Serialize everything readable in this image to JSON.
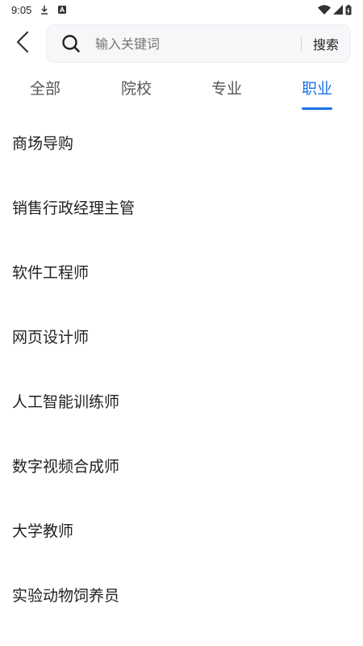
{
  "status_bar": {
    "time": "9:05",
    "icons": [
      "download-icon",
      "a-icon",
      "wifi-icon",
      "signal-icon",
      "battery-icon"
    ]
  },
  "header": {
    "back_icon": "chevron-left-icon",
    "search": {
      "icon": "search-icon",
      "placeholder": "输入关键词",
      "value": "",
      "button_label": "搜索"
    }
  },
  "tabs": [
    {
      "label": "全部",
      "active": false
    },
    {
      "label": "院校",
      "active": false
    },
    {
      "label": "专业",
      "active": false
    },
    {
      "label": "职业",
      "active": true
    }
  ],
  "list": {
    "items": [
      {
        "label": "商场导购"
      },
      {
        "label": "销售行政经理主管"
      },
      {
        "label": "软件工程师"
      },
      {
        "label": "网页设计师"
      },
      {
        "label": "人工智能训练师"
      },
      {
        "label": "数字视频合成师"
      },
      {
        "label": "大学教师"
      },
      {
        "label": "实验动物饲养员"
      }
    ]
  },
  "colors": {
    "accent": "#1a73e8",
    "search_bg": "#f6f7f9",
    "placeholder": "#b4b7bd"
  }
}
